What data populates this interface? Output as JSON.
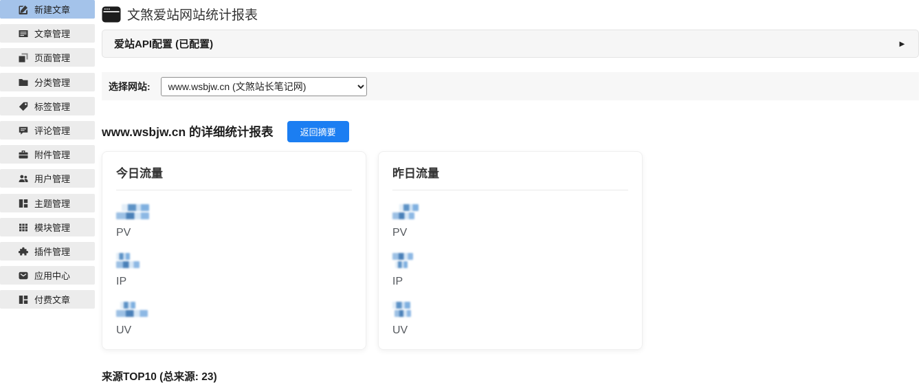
{
  "sidebar": {
    "groups": [
      {
        "items": [
          {
            "label": "新建文章",
            "icon": "edit-icon",
            "active": true
          },
          {
            "label": "文章管理",
            "icon": "newspaper-icon"
          },
          {
            "label": "页面管理",
            "icon": "pages-icon"
          }
        ]
      },
      {
        "items": [
          {
            "label": "分类管理",
            "icon": "folder-icon"
          },
          {
            "label": "标签管理",
            "icon": "tag-icon"
          },
          {
            "label": "评论管理",
            "icon": "comment-icon"
          },
          {
            "label": "附件管理",
            "icon": "briefcase-icon"
          },
          {
            "label": "用户管理",
            "icon": "users-icon"
          }
        ]
      },
      {
        "items": [
          {
            "label": "主题管理",
            "icon": "columns-icon"
          },
          {
            "label": "模块管理",
            "icon": "grid-icon"
          },
          {
            "label": "插件管理",
            "icon": "puzzle-icon"
          },
          {
            "label": "应用中心",
            "icon": "app-box-icon"
          },
          {
            "label": "付费文章",
            "icon": "columns-icon"
          }
        ]
      }
    ]
  },
  "header": {
    "title": "文煞爱站网站统计报表"
  },
  "accordion": {
    "label": "爱站API配置 (已配置)",
    "arrow": "►"
  },
  "site_select": {
    "label": "选择网站:",
    "selected_option": "www.wsbjw.cn (文煞站长笔记网)"
  },
  "report": {
    "title": "www.wsbjw.cn 的详细统计报表",
    "back_button_label": "返回摘要",
    "cards": [
      {
        "title": "今日流量",
        "stats": [
          {
            "label": "PV"
          },
          {
            "label": "IP"
          },
          {
            "label": "UV"
          }
        ]
      },
      {
        "title": "昨日流量",
        "stats": [
          {
            "label": "PV"
          },
          {
            "label": "IP"
          },
          {
            "label": "UV"
          }
        ]
      }
    ],
    "sources_heading": "来源TOP10 (总来源: 23)"
  },
  "colors": {
    "accent_blue": "#1b7ef2",
    "sidebar_active_bg": "#a4c3ea",
    "redacted_blue": "#5d92c6"
  }
}
